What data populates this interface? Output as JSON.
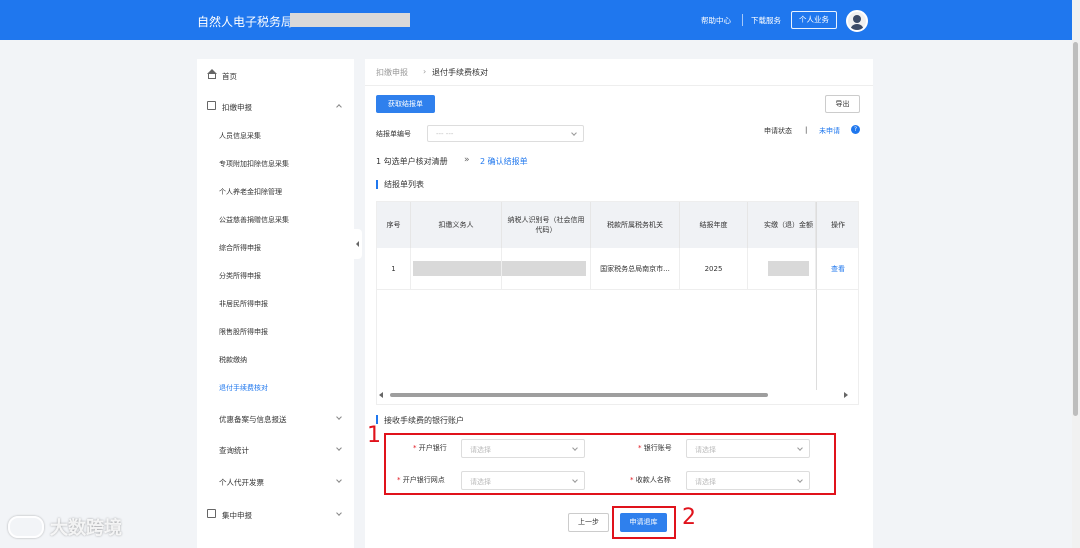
{
  "header": {
    "brand": "自然人电子税务局",
    "help": "帮助中心",
    "download": "下载服务",
    "personal": "个人业务"
  },
  "sidebar": {
    "home": "首页",
    "withhold": "扣缴申报",
    "sub_items": [
      "人员信息采集",
      "专项附加扣除信息采集",
      "个人养老金扣除管理",
      "公益慈善捐赠信息采集",
      "综合所得申报",
      "分类所得申报",
      "非居民所得申报",
      "限售股所得申报",
      "税款缴纳",
      "退付手续费核对"
    ],
    "active_sub": 9,
    "preferential": "优惠备案与信息报送",
    "query": "查询统计",
    "invoice": "个人代开发票",
    "centralized": "集中申报"
  },
  "breadcrumb": {
    "parent": "扣缴申报",
    "sep": "›",
    "current": "退付手续费核对"
  },
  "toolbar": {
    "fetch": "获取结报单",
    "export": "导出"
  },
  "filter": {
    "settlement_label": "结报单编号",
    "settlement_placeholder": "--- ---",
    "status_label": "申请状态",
    "status_sep": "|",
    "status_value": "未申请"
  },
  "steps": {
    "step1": "1 勾选单户核对清册",
    "arrow": "»",
    "step2": "2 确认结报单"
  },
  "table": {
    "section_title": "结报单列表",
    "headers": [
      "序号",
      "扣缴义务人",
      "纳税人识别号（社会信用代码）",
      "税款所属税务机关",
      "结报年度",
      "实缴（退）金额",
      "操作"
    ],
    "rows": [
      {
        "index": "1",
        "authority": "国家税务总局南京市...",
        "year": "2025",
        "action": "查看"
      }
    ]
  },
  "bank": {
    "section_title": "接收手续费的银行账户",
    "required_mark": "*",
    "fields": [
      {
        "label": "开户银行",
        "placeholder": "请选择"
      },
      {
        "label": "银行账号",
        "placeholder": "请选择"
      },
      {
        "label": "开户银行网点",
        "placeholder": "请选择"
      },
      {
        "label": "收款人名称",
        "placeholder": "请选择"
      }
    ]
  },
  "footer": {
    "prev": "上一步",
    "apply": "申请退库"
  },
  "annotations": {
    "n1": "1",
    "n2": "2"
  },
  "watermark": "大数跨境",
  "colors": {
    "primary": "#1f77ee",
    "annotation": "#e0121b"
  }
}
